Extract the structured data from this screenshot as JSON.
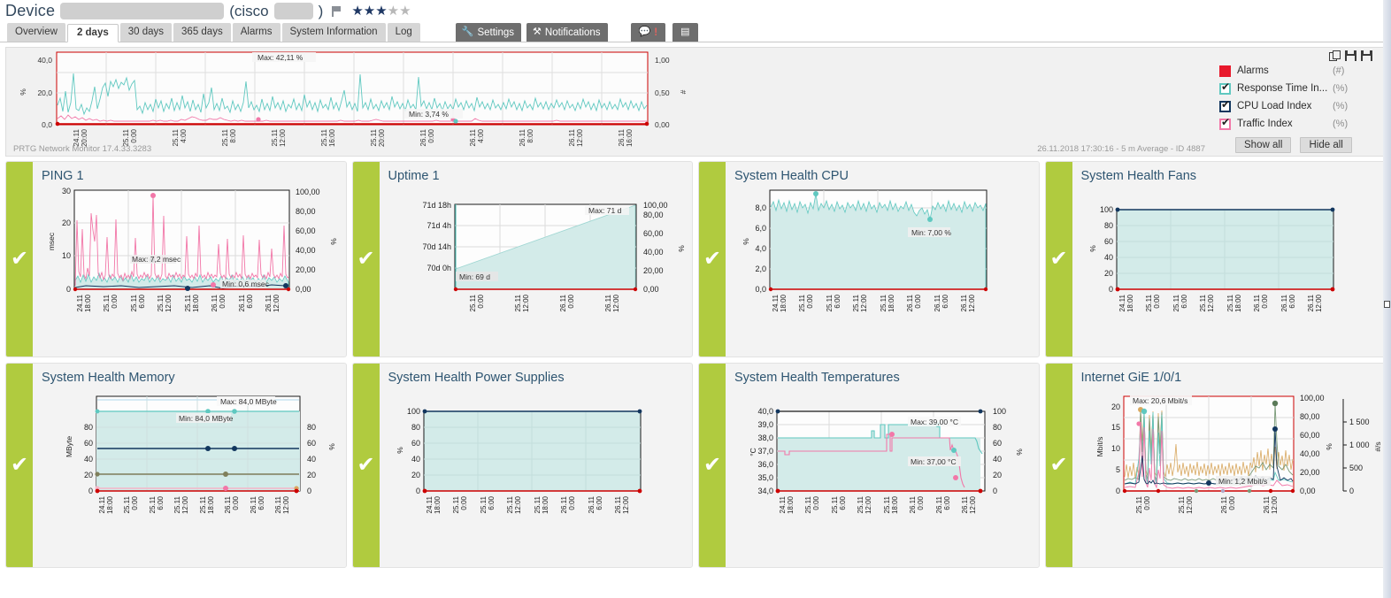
{
  "header": {
    "device_label": "Device",
    "device_name_redacted": "",
    "paren_open": "(cisco",
    "paren_close": ")",
    "flag_icon": "flag-icon",
    "stars_filled": 3,
    "stars_total": 5
  },
  "tabs": [
    {
      "label": "Overview",
      "active": false
    },
    {
      "label": "2 days",
      "active": true
    },
    {
      "label": "30 days",
      "active": false
    },
    {
      "label": "365 days",
      "active": false
    },
    {
      "label": "Alarms",
      "active": false
    },
    {
      "label": "System Information",
      "active": false
    },
    {
      "label": "Log",
      "active": false
    }
  ],
  "toolbar": {
    "settings_label": "Settings",
    "settings_icon": "wrench-icon",
    "notifications_label": "Notifications",
    "notifications_icon": "bell-icon",
    "comments_icon": "comment-icon",
    "comments_badge": "!",
    "report_icon": "report-icon"
  },
  "main_chart": {
    "legend_title_icons": [
      "copy-icon",
      "save-icon",
      "save-as-icon"
    ],
    "entries": [
      {
        "label": "Alarms",
        "unit": "(#)",
        "type": "solid",
        "color": "#e8192c",
        "checked": false
      },
      {
        "label": "Response Time In...",
        "unit": "(%)",
        "type": "check",
        "color": "#5fc8c0",
        "checked": true
      },
      {
        "label": "CPU Load Index",
        "unit": "(%)",
        "type": "check",
        "color": "#12365e",
        "checked": true
      },
      {
        "label": "Traffic Index",
        "unit": "(%)",
        "type": "check",
        "color": "#f277a8",
        "checked": true
      }
    ],
    "show_all": "Show all",
    "hide_all": "Hide all",
    "footer_left": "PRTG Network Monitor 17.4.33.3283",
    "footer_right": "26.11.2018 17:30:16 - 5 m Average - ID 4887",
    "max_label": "Max: 42,11 %",
    "min_label": "Min: 3,74 %"
  },
  "chart_data": [
    {
      "id": "main",
      "type": "line",
      "title": "",
      "ylabel": "%",
      "y2label": "#",
      "ylim": [
        0,
        45
      ],
      "yticks": [
        "0,0",
        "20,0",
        "40,0"
      ],
      "y2lim": [
        0,
        1
      ],
      "y2ticks": [
        "0,00",
        "0,50",
        "1,00"
      ],
      "xticks": [
        "24.11 20:00",
        "25.11 0:00",
        "25.11 4:00",
        "25.11 8:00",
        "25.11 12:00",
        "25.11 16:00",
        "25.11 20:00",
        "26.11 0:00",
        "26.11 4:00",
        "26.11 8:00",
        "26.11 12:00",
        "26.11 16:00"
      ],
      "annotations": [
        "Max: 42,11 %",
        "Min: 3,74 %"
      ],
      "series": [
        {
          "name": "Response Time Index",
          "color": "#5fc8c0",
          "unit": "%"
        },
        {
          "name": "Traffic Index",
          "color": "#f277a8",
          "unit": "%"
        },
        {
          "name": "Alarms",
          "color": "#cc0000",
          "unit": "#"
        }
      ]
    },
    {
      "id": "ping1",
      "type": "line",
      "title": "PING 1",
      "ylabel": "msec",
      "y2label": "%",
      "ylim": [
        0,
        32
      ],
      "yticks": [
        "0",
        "10",
        "20",
        "30"
      ],
      "y2lim": [
        0,
        105
      ],
      "y2ticks": [
        "0,00",
        "20,00",
        "40,00",
        "60,00",
        "80,00",
        "100,00"
      ],
      "xticks": [
        "24.11 18:00",
        "25.11 0:00",
        "25.11 6:00",
        "25.11 12:00",
        "25.11 18:00",
        "26.11 0:00",
        "26.11 6:00",
        "26.11 12:00"
      ],
      "annotations": [
        "Max: 7,2 msec",
        "Min: 0,6 msec"
      ]
    },
    {
      "id": "uptime1",
      "type": "area",
      "title": "Uptime 1",
      "ylabel": "",
      "y2label": "%",
      "yticks": [
        "70d 0h",
        "70d 14h",
        "71d 4h",
        "71d 18h"
      ],
      "y2lim": [
        0,
        100
      ],
      "y2ticks": [
        "0,00",
        "20,00",
        "40,00",
        "60,00",
        "80,00",
        "100,00"
      ],
      "xticks": [
        "25.11 0:00",
        "25.11 12:00",
        "26.11 0:00",
        "26.11 12:00"
      ],
      "annotations": [
        "Max: 71 d",
        "Min: 69 d"
      ]
    },
    {
      "id": "cpu",
      "type": "area",
      "title": "System Health CPU",
      "ylabel": "%",
      "ylim": [
        0,
        9.5
      ],
      "yticks": [
        "0,0",
        "2,0",
        "4,0",
        "6,0",
        "8,0"
      ],
      "xticks": [
        "24.11 18:00",
        "25.11 0:00",
        "25.11 6:00",
        "25.11 12:00",
        "25.11 18:00",
        "26.11 0:00",
        "26.11 6:00",
        "26.11 12:00"
      ],
      "annotations": [
        "Min: 7,00 %"
      ]
    },
    {
      "id": "fans",
      "type": "area",
      "title": "System Health Fans",
      "ylabel": "%",
      "ylim": [
        0,
        105
      ],
      "yticks": [
        "0",
        "20",
        "40",
        "60",
        "80",
        "100"
      ],
      "xticks": [
        "24.11 18:00",
        "25.11 0:00",
        "25.11 6:00",
        "25.11 12:00",
        "25.11 18:00",
        "26.11 0:00",
        "26.11 6:00",
        "26.11 12:00"
      ],
      "annotations": []
    },
    {
      "id": "memory",
      "type": "line",
      "title": "System Health Memory",
      "ylabel": "MByte",
      "y2label": "%",
      "ylim": [
        0,
        90
      ],
      "yticks": [
        "0",
        "20",
        "40",
        "60",
        "80"
      ],
      "y2lim": [
        0,
        95
      ],
      "y2ticks": [
        "0",
        "20",
        "40",
        "60",
        "80"
      ],
      "xticks": [
        "24.11 18:00",
        "25.11 0:00",
        "25.11 6:00",
        "25.11 12:00",
        "25.11 18:00",
        "26.11 0:00",
        "26.11 6:00",
        "26.11 12:00"
      ],
      "annotations": [
        "Max: 84,0 MByte",
        "Min: 84,0 MByte"
      ]
    },
    {
      "id": "power",
      "type": "area",
      "title": "System Health Power Supplies",
      "ylabel": "%",
      "ylim": [
        0,
        105
      ],
      "yticks": [
        "0",
        "20",
        "40",
        "60",
        "80",
        "100"
      ],
      "xticks": [
        "24.11 18:00",
        "25.11 0:00",
        "25.11 6:00",
        "25.11 12:00",
        "25.11 18:00",
        "26.11 0:00",
        "26.11 6:00",
        "26.11 12:00"
      ],
      "annotations": []
    },
    {
      "id": "temps",
      "type": "line",
      "title": "System Health Temperatures",
      "ylabel": "°C",
      "y2label": "%",
      "ylim": [
        34,
        40
      ],
      "yticks": [
        "34,0",
        "35,0",
        "36,0",
        "37,0",
        "38,0",
        "39,0",
        "40,0"
      ],
      "y2lim": [
        0,
        100
      ],
      "y2ticks": [
        "0",
        "20",
        "40",
        "60",
        "80",
        "100"
      ],
      "xticks": [
        "24.11 18:00",
        "25.11 0:00",
        "25.11 6:00",
        "25.11 12:00",
        "25.11 18:00",
        "26.11 0:00",
        "26.11 6:00",
        "26.11 12:00"
      ],
      "annotations": [
        "Max: 39,00 °C",
        "Min: 37,00 °C"
      ]
    },
    {
      "id": "internet",
      "type": "line",
      "title": "Internet GiE 1/0/1",
      "ylabel": "Mbit/s",
      "y2label": "%",
      "y3label": "#/s",
      "ylim": [
        0,
        22
      ],
      "yticks": [
        "0",
        "5",
        "10",
        "15",
        "20"
      ],
      "y2lim": [
        0,
        100
      ],
      "y2ticks": [
        "0,00",
        "20,00",
        "40,00",
        "60,00",
        "80,00",
        "100,00"
      ],
      "y3ticks": [
        "0",
        "500",
        "1 000",
        "1 500"
      ],
      "xticks": [
        "25.11 0:00",
        "25.11 12:00",
        "26.11 0:00",
        "26.11 12:00"
      ],
      "annotations": [
        "Max: 20,6 Mbit/s",
        "Min: 1,2 Mbit/s"
      ]
    }
  ],
  "cards": [
    {
      "title": "PING 1",
      "status": "ok",
      "status_icon": "check-icon"
    },
    {
      "title": "Uptime 1",
      "status": "ok",
      "status_icon": "check-icon"
    },
    {
      "title": "System Health CPU",
      "status": "ok",
      "status_icon": "check-icon"
    },
    {
      "title": "System Health Fans",
      "status": "ok",
      "status_icon": "check-icon"
    },
    {
      "title": "System Health Memory",
      "status": "ok",
      "status_icon": "check-icon"
    },
    {
      "title": "System Health Power Supplies",
      "status": "ok",
      "status_icon": "check-icon"
    },
    {
      "title": "System Health Temperatures",
      "status": "ok",
      "status_icon": "check-icon"
    },
    {
      "title": "Internet GiE 1/0/1",
      "status": "ok",
      "status_icon": "check-icon"
    }
  ],
  "colors": {
    "status_green": "#b0cb3f",
    "teal": "#5fc8c0",
    "teal_fill": "#d3ebe9",
    "pink": "#f277a8",
    "navy": "#12365e",
    "red": "#cc0000",
    "orange": "#d8a860",
    "title_blue": "#2e5571"
  }
}
